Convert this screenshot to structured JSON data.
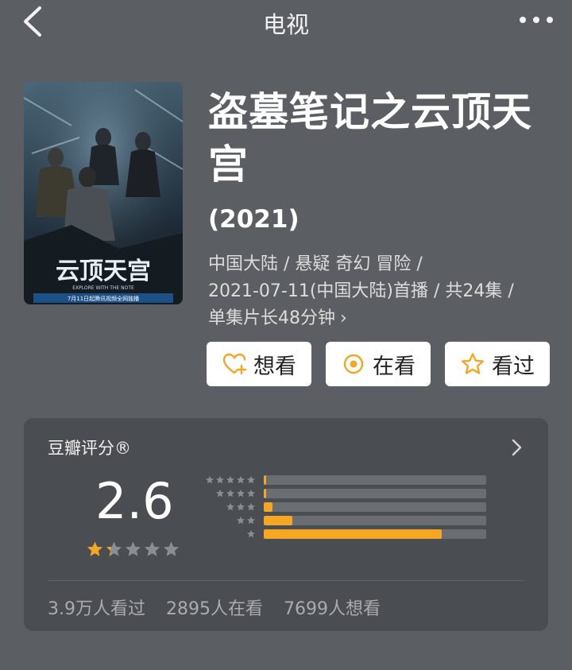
{
  "nav": {
    "title": "电视"
  },
  "poster": {
    "title_art": "云顶天宫",
    "subtitle_en": "EXPLORE WITH THE NOTE",
    "air_text": "7月11日起腾讯视频全网独播"
  },
  "movie": {
    "title": "盗墓笔记之云顶天宫",
    "year": "(2021)",
    "meta_line1": "中国大陆 / 悬疑 奇幻 冒险 /",
    "meta_line2": "2021-07-11(中国大陆)首播 / 共24集 /",
    "meta_line3": "单集片长48分钟"
  },
  "actions": {
    "want": "想看",
    "watching": "在看",
    "watched": "看过"
  },
  "rating": {
    "label": "豆瓣评分®",
    "score": "2.6",
    "star_value": 1.3,
    "distribution": [
      {
        "stars": 5,
        "fraction": 0.01
      },
      {
        "stars": 4,
        "fraction": 0.01
      },
      {
        "stars": 3,
        "fraction": 0.04
      },
      {
        "stars": 2,
        "fraction": 0.13
      },
      {
        "stars": 1,
        "fraction": 0.8
      }
    ],
    "stats": {
      "watched": "3.9万人看过",
      "watching": "2895人在看",
      "want": "7699人想看"
    }
  },
  "colors": {
    "background": "#5b5f63",
    "card": "#4a4d52",
    "accent": "#f5a623",
    "bar_track": "#6a6d72"
  },
  "icons": {
    "back": "chevron-left-icon",
    "more": "more-dots-icon",
    "want": "heart-plus-icon",
    "watching": "target-circle-icon",
    "watched": "star-outline-icon",
    "rating_more": "chevron-right-icon"
  }
}
